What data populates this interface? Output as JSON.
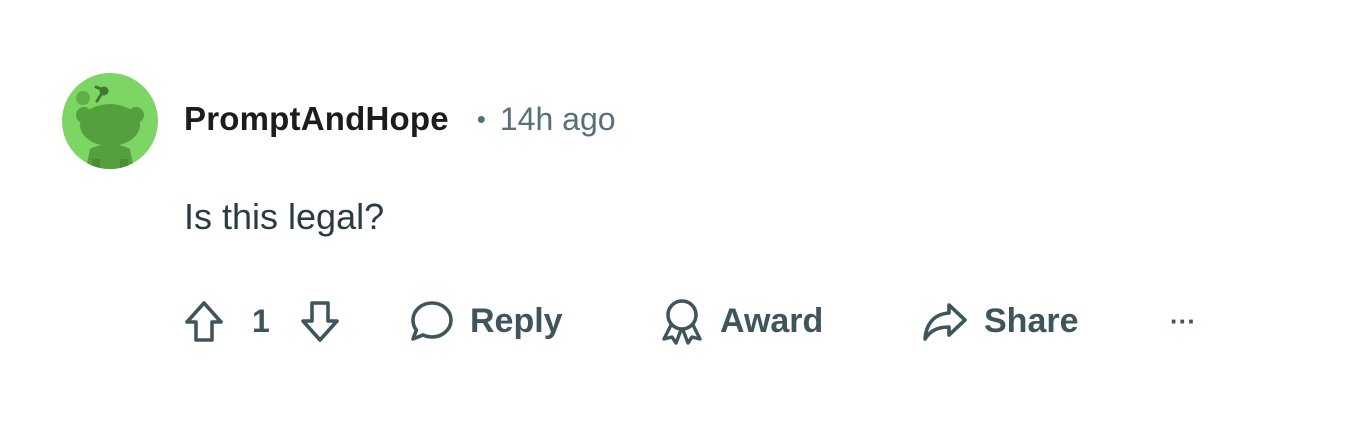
{
  "comment": {
    "author": "PromptAndHope",
    "separator": "•",
    "timestamp": "14h ago",
    "body": "Is this legal?",
    "avatar_icon": "snoo-avatar-icon",
    "avatar_color": "#7dd663"
  },
  "actions": {
    "upvote_icon": "upvote-arrow-icon",
    "vote_count": "1",
    "downvote_icon": "downvote-arrow-icon",
    "reply_label": "Reply",
    "award_label": "Award",
    "share_label": "Share",
    "more_label": "···"
  },
  "colors": {
    "text_muted": "#576f76",
    "icon_color": "#3f555c"
  }
}
